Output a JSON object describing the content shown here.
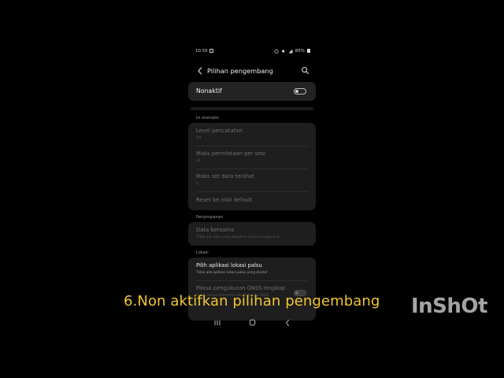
{
  "status_bar": {
    "time": "10.55",
    "battery": "85%"
  },
  "app_bar": {
    "title": "Pilihan pengembang",
    "back_icon": "chevron-left-icon",
    "search_icon": "search-icon"
  },
  "master_switch": {
    "label": "Nonaktif",
    "state": "off"
  },
  "sections": {
    "autofill": {
      "title": "Isi otomatis",
      "items": [
        {
          "title": "Level pencatatan",
          "subtitle": "Off"
        },
        {
          "title": "Maks permintaan per sesi",
          "subtitle": "10"
        },
        {
          "title": "Maks set data terlihat",
          "subtitle": "3"
        },
        {
          "title": "Reset ke nilai default",
          "subtitle": ""
        }
      ]
    },
    "storage": {
      "title": "Penyimpanan",
      "items": [
        {
          "title": "Data bersama",
          "subtitle": "Tidak ada data yang dibagikan untuk pengguna ini"
        }
      ]
    },
    "location": {
      "title": "Lokasi",
      "items": [
        {
          "title": "Pilih aplikasi lokasi palsu",
          "subtitle": "Tidak ada aplikasi lokasi palsu yang disetel"
        },
        {
          "title": "Paksa pengukuran GNSS lengkap",
          "subtitle": "Lacak semua konstelasi dan frekuensi GNSS"
        }
      ]
    }
  },
  "caption": "6.Non aktifkan pilihan  pengembang",
  "watermark": "InShOt",
  "colors": {
    "background": "#000000",
    "card": "#1e1e1e",
    "caption": "#f2c531"
  }
}
